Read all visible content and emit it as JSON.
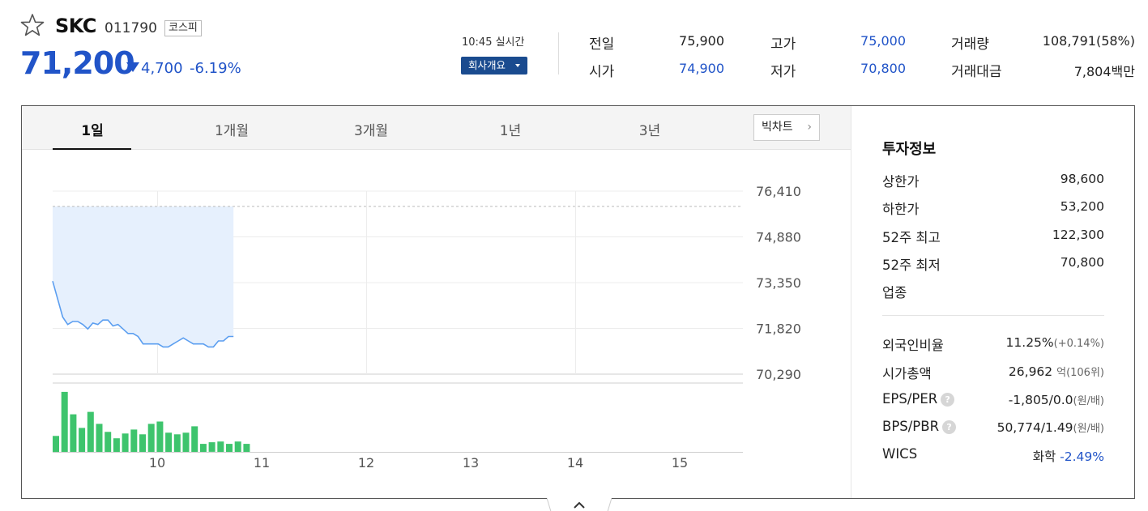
{
  "header": {
    "name": "SKC",
    "code": "011790",
    "market": "코스피",
    "price": "71,200",
    "change": "4,700",
    "change_pct": "-6.19%",
    "realtime": "10:45 실시간",
    "company_button": "회사개요"
  },
  "quote": {
    "prev_close_label": "전일",
    "prev_close": "75,900",
    "open_label": "시가",
    "open": "74,900",
    "high_label": "고가",
    "high": "75,000",
    "low_label": "저가",
    "low": "70,800",
    "volume_label": "거래량",
    "volume": "108,791(58%)",
    "amount_label": "거래대금",
    "amount": "7,804",
    "amount_unit": "백만"
  },
  "tabs": [
    "1일",
    "1개월",
    "3개월",
    "1년",
    "3년"
  ],
  "big_chart_label": "빅차트",
  "chart_data": {
    "type": "line",
    "yticks": [
      "76,410",
      "74,880",
      "73,350",
      "71,820",
      "70,290"
    ],
    "ylim": [
      70290,
      76410
    ],
    "xticks": [
      "10",
      "11",
      "12",
      "13",
      "14",
      "15"
    ],
    "prev_close_line": 75900,
    "price_series": [
      73400,
      72800,
      72200,
      71950,
      72050,
      72050,
      71950,
      71800,
      72000,
      71950,
      72100,
      72100,
      71900,
      71950,
      71800,
      71650,
      71650,
      71550,
      71300,
      71300,
      71300,
      71300,
      71200,
      71200,
      71300,
      71400,
      71500,
      71400,
      71300,
      71300,
      71300,
      71200,
      71200,
      71400,
      71400,
      71550,
      71550
    ],
    "volume_series": [
      20,
      75,
      47,
      30,
      50,
      35,
      25,
      17,
      23,
      28,
      22,
      35,
      38,
      24,
      22,
      24,
      32,
      10,
      12,
      13,
      10,
      13,
      10
    ]
  },
  "invest_info": {
    "title": "투자정보",
    "upper_limit_label": "상한가",
    "upper_limit": "98,600",
    "lower_limit_label": "하한가",
    "lower_limit": "53,200",
    "high52_label": "52주 최고",
    "high52": "122,300",
    "low52_label": "52주 최저",
    "low52": "70,800",
    "sector_label": "업종",
    "foreign_label": "외국인비율",
    "foreign": "11.25%",
    "foreign_chg": "(+0.14%)",
    "cap_label": "시가총액",
    "cap": "26,962",
    "cap_unit": "억(106위)",
    "eps_label": "EPS/PER",
    "eps": "-1,805/0.0",
    "eps_unit": "(원/배)",
    "bps_label": "BPS/PBR",
    "bps": "50,774/1.49",
    "bps_unit": "(원/배)",
    "wics_label": "WICS",
    "wics": "화학",
    "wics_chg": "-2.49%",
    "help_mark": "?"
  },
  "colors": {
    "down": "#2154c8",
    "up": "#e0191e",
    "volume": "#3ec46d",
    "line": "#5b9ef0"
  }
}
